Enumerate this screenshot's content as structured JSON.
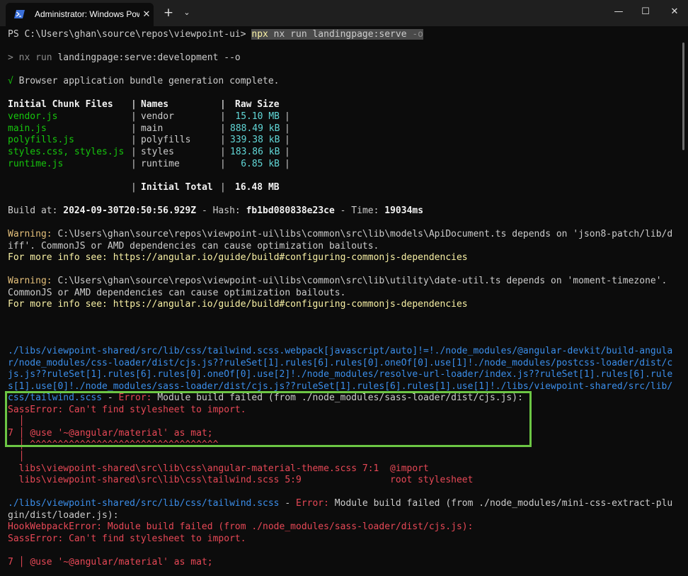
{
  "window": {
    "tab_title": "Administrator: Windows PowerShell",
    "tab_icon": "powershell-icon",
    "close_tab_icon": "✕",
    "new_tab_icon": "+",
    "dropdown_icon": "⌄",
    "minimize_icon": "—",
    "maximize_icon": "☐",
    "close_icon": "✕"
  },
  "terminal": {
    "prompt": "PS C:\\Users\\ghan\\source\\repos\\viewpoint-ui> ",
    "command": {
      "npx": "npx",
      "rest": " nx run landingpage:serve ",
      "flag": "-o"
    },
    "nx_run": {
      "prefix": "> ",
      "cmd": "nx run",
      "target": " landingpage:serve:development --o"
    },
    "bundle_complete": {
      "check": "√",
      "text": " Browser application bundle generation complete."
    },
    "table": {
      "header": {
        "files": "Initial Chunk Files",
        "names": "Names",
        "size": "Raw Size"
      },
      "rows": [
        {
          "file": "vendor.js",
          "name": "vendor",
          "size": "15.10 MB"
        },
        {
          "file": "main.js",
          "name": "main",
          "size": "888.49 kB"
        },
        {
          "file": "polyfills.js",
          "name": "polyfills",
          "size": "339.38 kB"
        },
        {
          "file": "styles.css, styles.js",
          "name": "styles",
          "size": "183.86 kB"
        },
        {
          "file": "runtime.js",
          "name": "runtime",
          "size": "6.85 kB"
        }
      ],
      "total": {
        "label": "Initial Total",
        "size": "16.48 MB"
      }
    },
    "build": {
      "label1": "Build at: ",
      "date": "2024-09-30T20:50:56.929Z",
      "label2": " - Hash: ",
      "hash": "fb1bd080838e23ce",
      "label3": " - Time: ",
      "time": "19034ms"
    },
    "warning1": {
      "label": "Warning:",
      "text1": " C:\\Users\\ghan\\source\\repos\\viewpoint-ui\\libs\\common\\src\\lib\\models\\ApiDocument.ts depends on 'json8-patch/lib/d",
      "text2": "iff'. CommonJS or AMD dependencies can cause optimization bailouts.",
      "info_label": "For more info see:",
      "info_url": " https://angular.io/guide/build#configuring-commonjs-dependencies"
    },
    "warning2": {
      "label": "Warning:",
      "text1": " C:\\Users\\ghan\\source\\repos\\viewpoint-ui\\libs\\common\\src\\lib\\utility\\date-util.ts depends on 'moment-timezone'.",
      "text2": "CommonJS or AMD dependencies can cause optimization bailouts.",
      "info_label": "For more info see:",
      "info_url": " https://angular.io/guide/build#configuring-commonjs-dependencies"
    },
    "error1": {
      "path1": "./libs/viewpoint-shared/src/lib/css/tailwind.scss.webpack[javascript/auto]!=!./node_modules/@angular-devkit/build-angula",
      "path2": "r/node_modules/css-loader/dist/cjs.js??ruleSet[1].rules[6].rules[0].oneOf[0].use[1]!./node_modules/postcss-loader/dist/c",
      "path3": "js.js??ruleSet[1].rules[6].rules[0].oneOf[0].use[2]!./node_modules/resolve-url-loader/index.js??ruleSet[1].rules[6].rule",
      "path4": "s[1].use[0]!./node_modules/sass-loader/dist/cjs.js??ruleSet[1].rules[6].rules[1].use[1]!./libs/viewpoint-shared/src/lib/",
      "path5": "css/tailwind.scss",
      "dash": " - ",
      "error_label": "Error:",
      "error_msg": " Module build failed (from ./node_modules/sass-loader/dist/cjs.js):",
      "sass_error": "SassError: Can't find stylesheet to import.",
      "gutter_blank": "  │",
      "code_line_no": "7",
      "code_bar": " │ ",
      "code": "@use '~@angular/material' as mat;",
      "carets": "  │ ^^^^^^^^^^^^^^^^^^^^^^^^^^^^^^^^^^",
      "trace1_file": "  libs\\viewpoint-shared\\src\\lib\\css\\angular-material-theme.scss 7:1  ",
      "trace1_ctx": "@import",
      "trace2_file": "  libs\\viewpoint-shared\\src\\lib\\css\\tailwind.scss 5:9                ",
      "trace2_ctx": "root stylesheet"
    },
    "error2": {
      "path": "./libs/viewpoint-shared/src/lib/css/tailwind.scss",
      "dash": " - ",
      "error_label": "Error:",
      "error_msg1": " Module build failed (from ./node_modules/mini-css-extract-plu",
      "error_msg2": "gin/dist/loader.js):",
      "hook_error": "HookWebpackError: Module build failed (from ./node_modules/sass-loader/dist/cjs.js):",
      "sass_error": "SassError: Can't find stylesheet to import.",
      "code_line_no": "7",
      "code_bar": " │ ",
      "code": "@use '~@angular/material' as mat;"
    }
  },
  "colors": {
    "background": "#0c0c0c",
    "highlight_box": "#6cc644",
    "error": "#e74856",
    "warning": "#e5c07b",
    "path": "#3b8eea",
    "file_green": "#16c60c",
    "size_cyan": "#61d6d6"
  }
}
